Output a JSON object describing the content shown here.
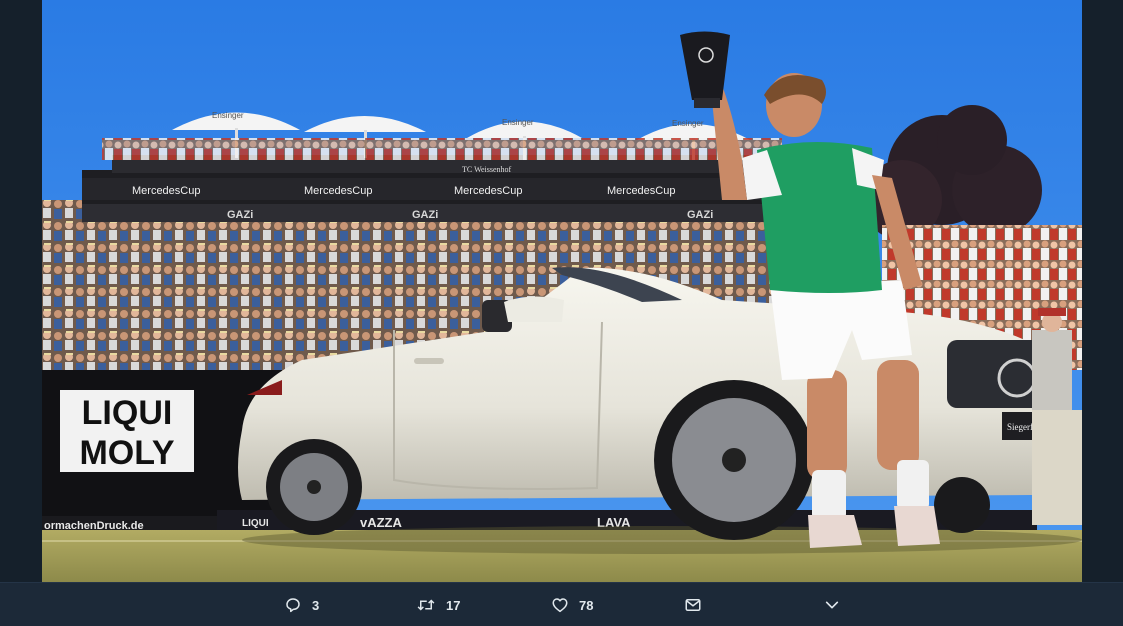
{
  "photo": {
    "signs": {
      "liqui_line1": "LIQUI",
      "liqui_line2": "MOLY",
      "banner_url": "ormachenDruck.de",
      "mercedes_cup": "MercedesCup",
      "ensinger": "Ensinger",
      "club": "TC Weissenhof",
      "gazi": "GAZi",
      "lavazza": "vAZZA",
      "lavazza2": "LAVA",
      "liqui_small": "LIQUI",
      "car_plate": "Siegerfahrzeug"
    }
  },
  "actions": {
    "reply_count": "3",
    "retweet_count": "17",
    "like_count": "78"
  },
  "colors": {
    "background": "#15202b",
    "action_bar": "#1c2938",
    "sky": "#2f80e8",
    "jersey": "#1f9e62",
    "grass": "#a7a25b"
  }
}
